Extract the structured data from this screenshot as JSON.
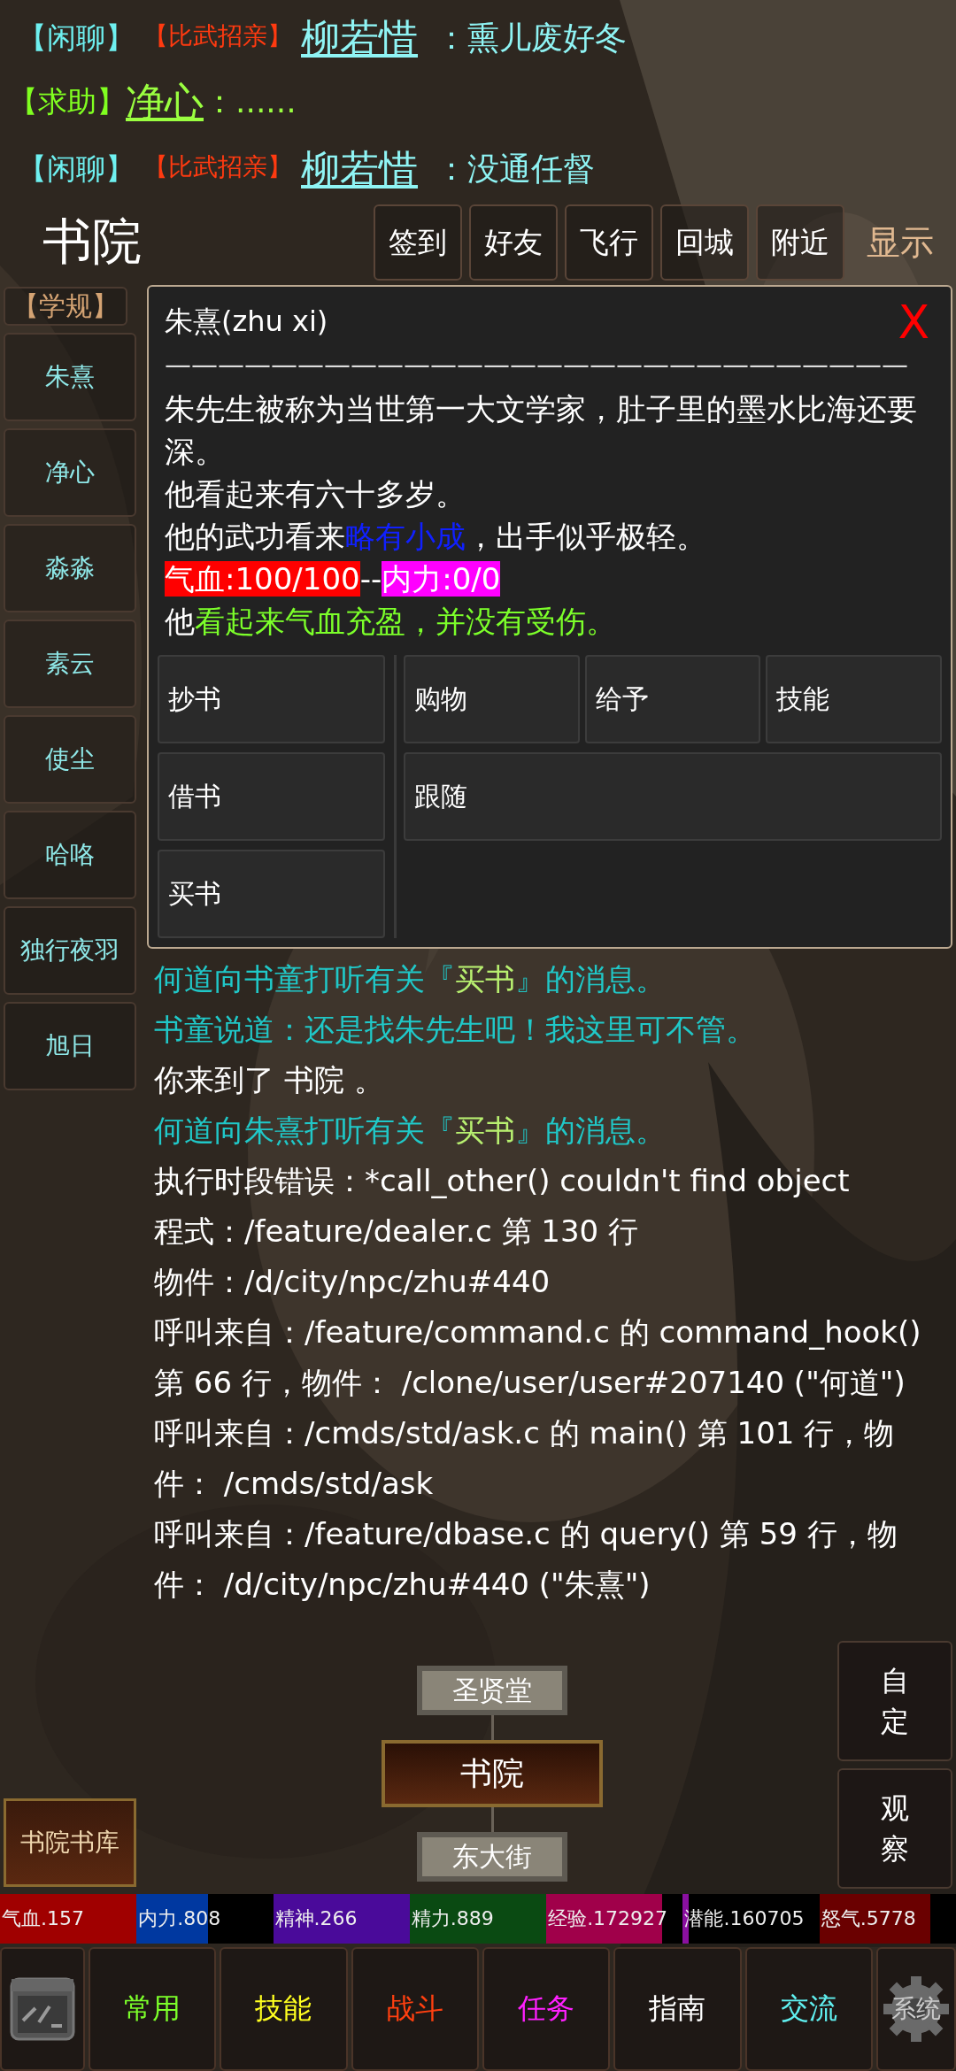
{
  "chat": [
    {
      "channel": "【闲聊】",
      "kind": "chat",
      "tag": "【比武招亲】",
      "name": "柳若惜",
      "message": "：熏儿废好冬"
    },
    {
      "channel": "【求助】",
      "kind": "help",
      "name": "净心",
      "message": "：......"
    },
    {
      "channel": "【闲聊】",
      "kind": "chat",
      "tag": "【比武招亲】",
      "name": "柳若惜",
      "message": "：没通任督"
    }
  ],
  "location": "书院",
  "top_buttons": [
    "签到",
    "好友",
    "飞行",
    "回城",
    "附近"
  ],
  "display_toggle": "显示",
  "sidebar": [
    {
      "label": "【学规】",
      "kind": "rule"
    },
    {
      "label": "朱熹",
      "kind": "npc"
    },
    {
      "label": "净心",
      "kind": "npc"
    },
    {
      "label": "淼淼",
      "kind": "npc"
    },
    {
      "label": "素云",
      "kind": "npc"
    },
    {
      "label": "使尘",
      "kind": "npc"
    },
    {
      "label": "哈咯",
      "kind": "npc"
    },
    {
      "label": "独行夜羽",
      "kind": "npc"
    },
    {
      "label": "旭日",
      "kind": "npc"
    }
  ],
  "dialog": {
    "title": "朱熹(zhu xi)",
    "close": "X",
    "rule": "————————————————————————————",
    "lines": [
      [
        {
          "text": "朱先生被称为当世第一大文学家，肚子里的墨水比海还要深。",
          "kind": "plain"
        }
      ],
      [
        {
          "text": "他看起来有六十多岁。",
          "kind": "plain"
        }
      ],
      [
        {
          "text": "他的武功看来",
          "kind": "plain"
        },
        {
          "text": "略有小成",
          "kind": "blue"
        },
        {
          "text": "，出手似乎极轻。",
          "kind": "plain"
        }
      ],
      [
        {
          "text": "气血:100/100",
          "kind": "hp"
        },
        {
          "text": "--",
          "kind": "plain"
        },
        {
          "text": "内力:0/0",
          "kind": "mp"
        }
      ],
      [
        {
          "text": "他",
          "kind": "plain"
        },
        {
          "text": "看起来气血充盈，并没有受伤。",
          "kind": "green"
        }
      ]
    ],
    "left_actions": [
      "抄书",
      "借书",
      "买书"
    ],
    "right_actions": [
      [
        "购物",
        "给予",
        "技能"
      ],
      [
        "跟随"
      ]
    ]
  },
  "log": [
    [
      {
        "text": "何道向书童打听有关『",
        "kind": "system"
      },
      {
        "text": "买书",
        "kind": "highlight"
      },
      {
        "text": "』的消息。",
        "kind": "system"
      }
    ],
    [
      {
        "text": "书童说道：还是找朱先生吧！我这里可不管。",
        "kind": "system"
      }
    ],
    [
      {
        "text": "你来到了 书院 。",
        "kind": "plain"
      }
    ],
    [
      {
        "text": "何道向朱熹打听有关『",
        "kind": "system"
      },
      {
        "text": "买书",
        "kind": "highlight"
      },
      {
        "text": "』的消息。",
        "kind": "system"
      }
    ],
    [
      {
        "text": "执行时段错误：*call_other() couldn't find object",
        "kind": "plain"
      }
    ],
    [
      {
        "text": "程式：/feature/dealer.c 第 130 行",
        "kind": "plain"
      }
    ],
    [
      {
        "text": "物件：/d/city/npc/zhu#440",
        "kind": "plain"
      }
    ],
    [
      {
        "text": "呼叫来自：/feature/command.c 的 command_hook() 第 66 行，物件： /clone/user/user#207140 (\"何道\")",
        "kind": "plain"
      }
    ],
    [
      {
        "text": "呼叫来自：/cmds/std/ask.c 的 main() 第 101 行，物件： /cmds/std/ask",
        "kind": "plain"
      }
    ],
    [
      {
        "text": "呼叫来自：/feature/dbase.c 的 query() 第 59 行，物件： /d/city/npc/zhu#440 (\"朱熹\")",
        "kind": "plain"
      }
    ]
  ],
  "map": {
    "north": "圣贤堂",
    "current": "书院",
    "south": "东大街",
    "side": "书院书库"
  },
  "side_buttons": [
    "自定",
    "观察"
  ],
  "stats": [
    {
      "label": "气血.157",
      "color": "#a00000",
      "level": 1
    },
    {
      "label": "内力.808",
      "color": "#0038a0",
      "level": 0.52
    },
    {
      "label": "精神.266",
      "color": "#4a0a9a",
      "level": 1
    },
    {
      "label": "精力.889",
      "color": "#0a4a12",
      "level": 1
    },
    {
      "label": "经验.172927",
      "color": "#a0004a",
      "level": 0.85
    },
    {
      "label": "潜能.160705",
      "color": "#8a10a0",
      "level": 0.04
    },
    {
      "label": "怒气.5778",
      "color": "#6a0000",
      "level": 0.81
    }
  ],
  "nav": [
    {
      "label": "常用",
      "color": "#7cff2a"
    },
    {
      "label": "技能",
      "color": "#ffff20"
    },
    {
      "label": "战斗",
      "color": "#ff4010"
    },
    {
      "label": "任务",
      "color": "#ff20ff"
    },
    {
      "label": "指南",
      "color": "#ffffff"
    },
    {
      "label": "交流",
      "color": "#60f0f0"
    }
  ],
  "system_label": "系统"
}
